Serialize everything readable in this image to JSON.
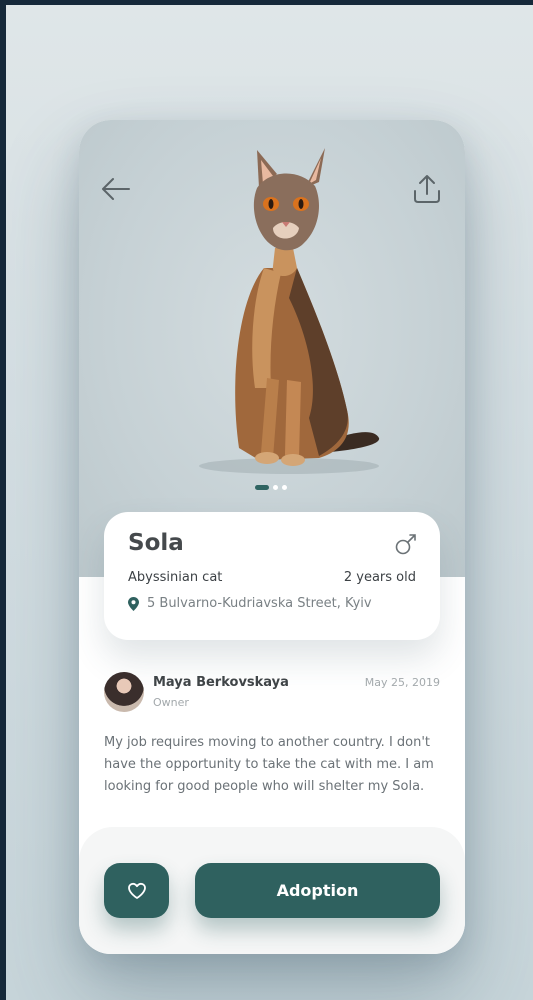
{
  "pet": {
    "name": "Sola",
    "breed": "Abyssinian cat",
    "age": "2 years old",
    "address": "5 Bulvarno-Kudriavska Street, Kyiv",
    "gender_icon": "male-symbol-icon"
  },
  "gallery": {
    "slide_count": 3,
    "active_slide": 1
  },
  "owner": {
    "name": "Maya Berkovskaya",
    "role": "Owner",
    "date": "May 25, 2019"
  },
  "story": "My job requires moving to another country. I don't have the opportunity to take the cat with me. I am looking for good people who will shelter my Sola.",
  "actions": {
    "favorite_icon": "heart-icon",
    "adopt_label": "Adoption"
  },
  "colors": {
    "accent": "#2f615f",
    "hero_background": "#c6d1d5",
    "page_background": "#16293a"
  },
  "icons": {
    "back": "arrow-left-icon",
    "share": "share-upload-icon",
    "location": "location-pin-icon"
  }
}
